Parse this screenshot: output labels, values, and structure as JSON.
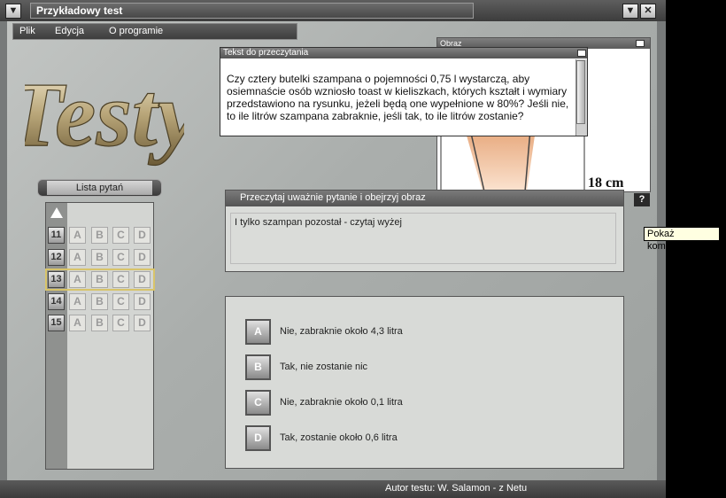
{
  "window": {
    "title": "Przykładowy test",
    "menu_icon": "triangle-down-icon",
    "min_icon": "triangle-down-icon",
    "close_icon": "close-icon"
  },
  "menu": {
    "items": [
      {
        "label": "Plik"
      },
      {
        "label": "Edycja"
      },
      {
        "label": "O programie"
      }
    ]
  },
  "logo_text": "Testy",
  "question_list": {
    "button_label": "Lista pytań",
    "scroll_up_icon": "triangle-up-icon",
    "rows": [
      {
        "number": "11",
        "options": [
          "A",
          "B",
          "C",
          "D"
        ],
        "selected": false
      },
      {
        "number": "12",
        "options": [
          "A",
          "B",
          "C",
          "D"
        ],
        "selected": false
      },
      {
        "number": "13",
        "options": [
          "A",
          "B",
          "C",
          "D"
        ],
        "selected": true
      },
      {
        "number": "14",
        "options": [
          "A",
          "B",
          "C",
          "D"
        ],
        "selected": false
      },
      {
        "number": "15",
        "options": [
          "A",
          "B",
          "C",
          "D"
        ],
        "selected": false
      }
    ]
  },
  "reading_panel": {
    "title": "Przeczytaj uważnie pytanie i obejrzyj obraz",
    "text": "I tylko szampan pozostał - czytaj wyżej",
    "help_label": "?"
  },
  "tooltip": "Pokaż komentarz",
  "image_window": {
    "title": "Obraz",
    "dimension_label": "18 cm"
  },
  "text_window": {
    "title": "Tekst do przeczytania",
    "body": "Czy cztery butelki szampana o pojemności 0,75 l wystarczą, aby osiemnaście osób wzniosło toast w kieliszkach, których kształt i wymiary przedstawiono na rysunku, jeżeli będą one wypełnione w 80%? Jeśli nie, to ile litrów szampana zabraknie, jeśli tak, to ile litrów zostanie?"
  },
  "answers": [
    {
      "letter": "A",
      "text": "Nie, zabraknie około 4,3 litra"
    },
    {
      "letter": "B",
      "text": "Tak, nie zostanie nic"
    },
    {
      "letter": "C",
      "text": "Nie, zabraknie około 0,1 litra"
    },
    {
      "letter": "D",
      "text": "Tak, zostanie około 0,6 litra"
    }
  ],
  "status": {
    "author": "Autor testu: W. Salamon - z Netu"
  }
}
